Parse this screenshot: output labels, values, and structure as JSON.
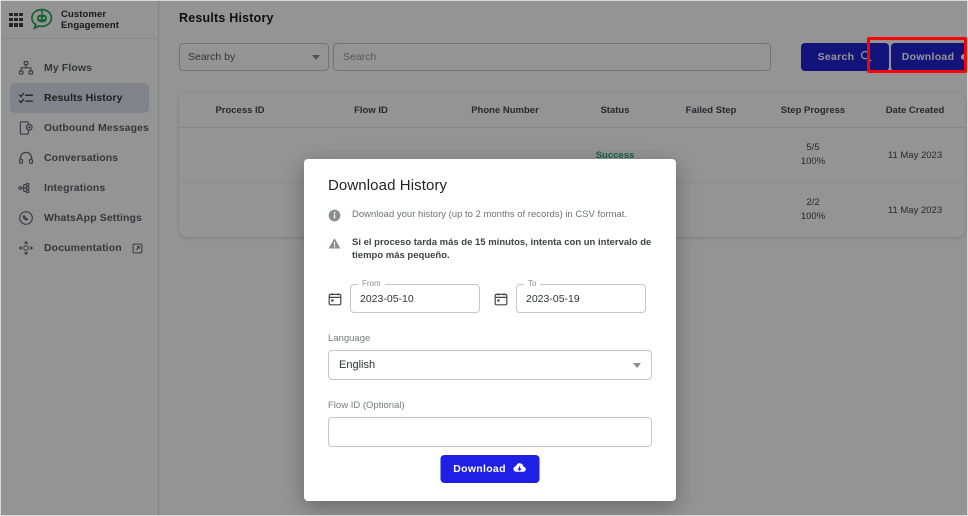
{
  "brand": {
    "apps_icon": "apps-grid-icon",
    "logo_icon": "chatbot-logo-icon",
    "line1": "Customer",
    "line2": "Engagement",
    "logo_color": "#1faa55"
  },
  "sidebar": {
    "items": [
      {
        "label": "My Flows",
        "icon": "org-chart-icon",
        "active": false,
        "external": false
      },
      {
        "label": "Results History",
        "icon": "checklist-icon",
        "active": true,
        "external": false
      },
      {
        "label": "Outbound Messages",
        "icon": "mobile-message-icon",
        "active": false,
        "external": false
      },
      {
        "label": "Conversations",
        "icon": "headset-icon",
        "active": false,
        "external": false
      },
      {
        "label": "Integrations",
        "icon": "integrations-icon",
        "active": false,
        "external": false
      },
      {
        "label": "WhatsApp Settings",
        "icon": "whatsapp-icon",
        "active": false,
        "external": false
      },
      {
        "label": "Documentation",
        "icon": "move-arrows-icon",
        "active": false,
        "external": true
      }
    ],
    "active_bg": "#dde3ee"
  },
  "page": {
    "title": "Results History"
  },
  "toolbar": {
    "search_by_label": "Search by",
    "search_placeholder": "Search",
    "search_value": "",
    "search_button_label": "Search",
    "search_button_icon": "search-icon",
    "download_button_label": "Download",
    "download_button_icon": "cloud-download-icon",
    "button_color": "#2121d6"
  },
  "table": {
    "columns": [
      "Process ID",
      "Flow ID",
      "Phone Number",
      "Status",
      "Failed Step",
      "Step Progress",
      "Date Created"
    ],
    "rows": [
      {
        "process_id": "",
        "flow_id": "",
        "phone_number": "",
        "status": "Success",
        "failed_step": "",
        "step_progress_count": "5/5",
        "step_progress_pct": "100%",
        "date_created": "11 May 2023"
      },
      {
        "process_id": "",
        "flow_id": "",
        "phone_number": "",
        "status": "",
        "failed_step": "",
        "step_progress_count": "2/2",
        "step_progress_pct": "100%",
        "date_created": "11 May 2023"
      }
    ],
    "status_success_color": "#19a974"
  },
  "modal": {
    "title": "Download History",
    "info_icon": "info-circle-icon",
    "info_text": "Download your history (up to 2 months of records) in CSV format.",
    "warning_icon": "warning-triangle-icon",
    "warning_text": "Si el proceso tarda más de 15 minutos, intenta con un intervalo de tiempo más pequeño.",
    "from": {
      "legend": "From",
      "value": "2023-05-10",
      "icon": "calendar-icon"
    },
    "to": {
      "legend": "To",
      "value": "2023-05-19",
      "icon": "calendar-icon"
    },
    "language": {
      "label": "Language",
      "value": "English",
      "caret": "chevron-down-icon"
    },
    "flow_id": {
      "label": "Flow ID (Optional)",
      "value": "",
      "placeholder": ""
    },
    "download_button_label": "Download",
    "download_button_icon": "cloud-download-icon",
    "download_button_color": "#1f1fe6"
  },
  "annotation": {
    "target": "download-button-top",
    "color": "#ff0000"
  }
}
